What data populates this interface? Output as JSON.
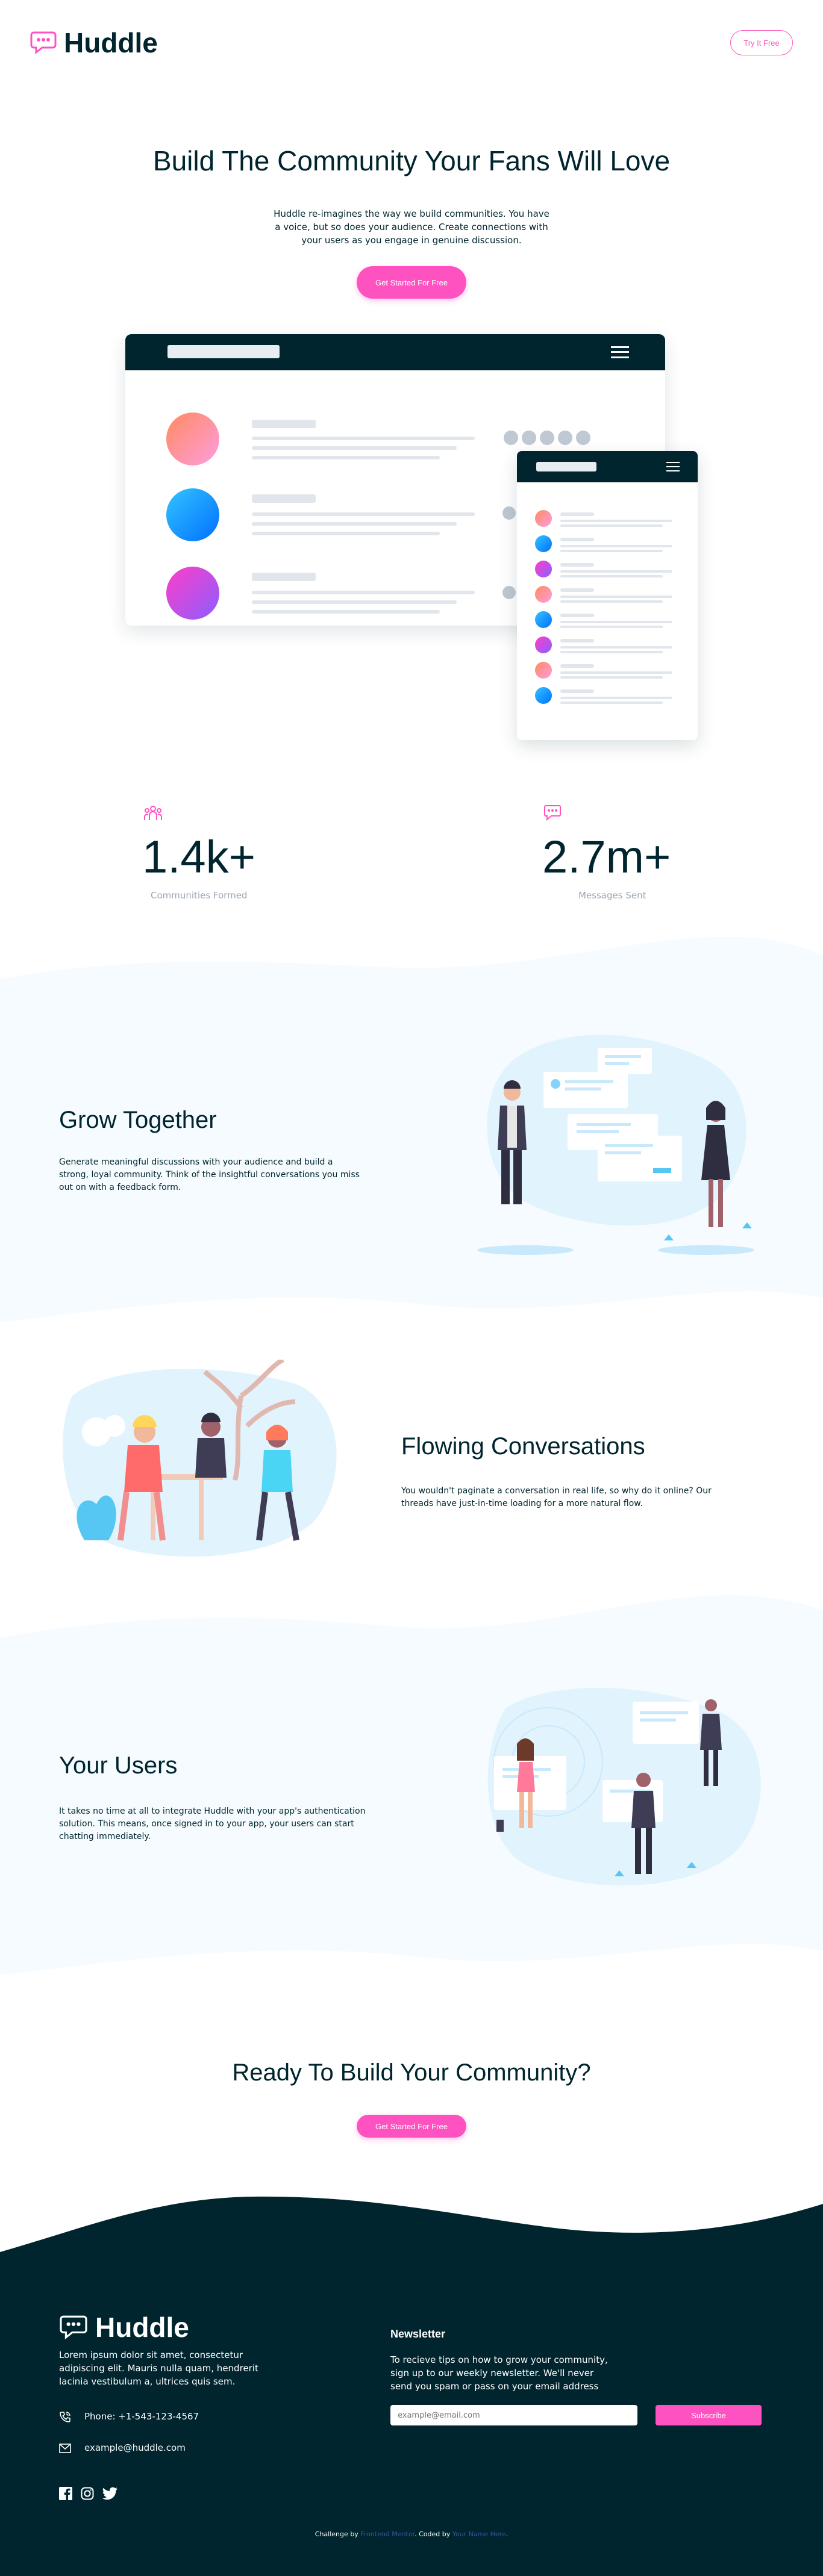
{
  "header": {
    "brand": "Huddle",
    "try_label": "Try It Free"
  },
  "hero": {
    "title": "Build The Community Your Fans Will Love",
    "description": "Huddle re-imagines the way we build communities. You have a voice, but so does your audience. Create connections with your users as you engage in genuine discussion.",
    "cta_label": "Get Started For Free"
  },
  "stats": [
    {
      "value": "1.4k+",
      "label": "Communities Formed",
      "icon": "communities-icon"
    },
    {
      "value": "2.7m+",
      "label": "Messages Sent",
      "icon": "messages-icon"
    }
  ],
  "features": [
    {
      "title": "Grow Together",
      "text": "Generate meaningful discussions with your audience and build a strong, loyal community. Think of the insightful conversations you miss out on with a feedback form."
    },
    {
      "title": "Flowing Conversations",
      "text": "You wouldn't paginate a conversation in real life, so why do it online? Our threads have just-in-time loading for a more natural flow."
    },
    {
      "title": "Your Users",
      "text": "It takes no time at all to integrate Huddle with your app's authentication solution. This means, once signed in to your app, your users can start chatting immediately."
    }
  ],
  "cta": {
    "title": "Ready To Build Your Community?",
    "button_label": "Get Started For Free"
  },
  "footer": {
    "brand": "Huddle",
    "about": "Lorem ipsum dolor sit amet, consectetur adipiscing elit. Mauris nulla quam, hendrerit lacinia vestibulum a, ultrices quis sem.",
    "phone": "Phone: +1-543-123-4567",
    "email": "example@huddle.com",
    "newsletter_title": "Newsletter",
    "newsletter_text": "To recieve tips on how to grow your community, sign up to our weekly newsletter. We'll never send you spam or pass on your email address",
    "email_placeholder": "example@email.com",
    "subscribe_label": "Subscribe",
    "attribution_prefix": "Challenge by",
    "attribution_link1": "Frontend Mentor",
    "attribution_mid": ". Coded by",
    "attribution_link2": "Your Name Here",
    "attribution_suffix": "."
  },
  "colors": {
    "pink": "#ff52c1",
    "dark": "#00252e",
    "pale": "#f5fbff"
  }
}
